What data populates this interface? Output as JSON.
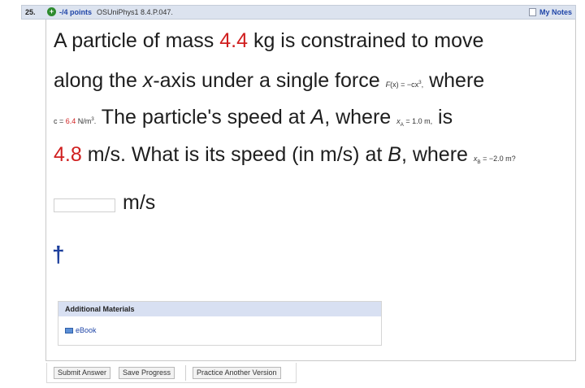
{
  "header": {
    "number": "25.",
    "points": "-/4 points",
    "source": "OSUniPhys1 8.4.P.047.",
    "notes_label": "My Notes"
  },
  "question": {
    "l1_a": "A particle of mass ",
    "mass": "4.4",
    "l1_b": " kg is constrained to move",
    "l2_a": "along the ",
    "l2_x": "x",
    "l2_b": "-axis under a single force ",
    "force_F": "F",
    "force_mid": "(x) = −cx",
    "force_exp": "3",
    "force_end": ",",
    "l2_c": " where",
    "c_a": "c = ",
    "c_val": "6.4",
    "c_b": " N/m",
    "c_exp": "3",
    "c_end": ".",
    "l3_a": " The particle's speed at ",
    "l3_A": "A",
    "l3_b": ", where ",
    "xA_x": "x",
    "xA_sub": "A",
    "xA_val": " = 1.0 m,",
    "l3_c": " is",
    "speed": "4.8",
    "l4_a": " m/s. What is its speed (in m/s) at ",
    "l4_B": "B",
    "l4_b": ", where ",
    "xB_x": "x",
    "xB_sub": "B",
    "xB_val": " = −2.0 m?",
    "units": "m/s",
    "answer_value": "",
    "dagger": "†"
  },
  "materials": {
    "title": "Additional Materials",
    "ebook": "eBook"
  },
  "buttons": {
    "submit": "Submit Answer",
    "save": "Save Progress",
    "practice": "Practice Another Version"
  },
  "colors": {
    "header_bg": "#dce3ef",
    "link_blue": "#2046a8",
    "value_red": "#d01f1f",
    "plus_green": "#2e8b2e"
  }
}
